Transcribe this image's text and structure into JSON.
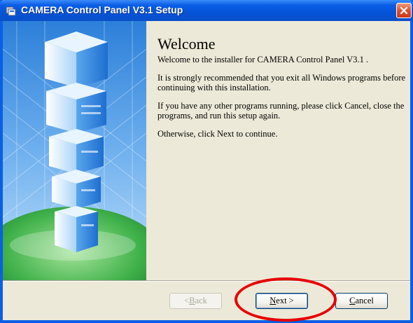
{
  "window": {
    "title": "CAMERA Control Panel V3.1 Setup",
    "title_icon": "installer-icon",
    "close_icon": "close-icon"
  },
  "side_image": {
    "icon": "building-globe-illustration"
  },
  "content": {
    "heading": "Welcome",
    "paragraphs": [
      "Welcome to the installer for CAMERA Control Panel V3.1 .",
      "It is strongly recommended that you exit all Windows programs before continuing with this installation.",
      "If you have any other programs running, please click Cancel, close the programs, and run this setup again.",
      "Otherwise, click Next to continue."
    ]
  },
  "buttons": {
    "back": {
      "accel": "B",
      "rest": "ack",
      "prefix": "< "
    },
    "next": {
      "accel": "N",
      "rest": "ext >"
    },
    "cancel": {
      "accel": "C",
      "rest": "ancel"
    }
  },
  "annotation": {
    "color": "#e60000"
  },
  "colors": {
    "titlebar": "#0553d8",
    "dialog_bg": "#ece9d8"
  }
}
